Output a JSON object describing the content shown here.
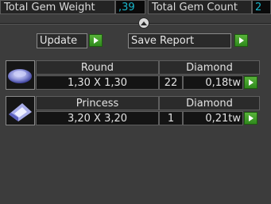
{
  "header": {
    "weight_label": "Total Gem Weight",
    "weight_value": ",39",
    "count_label": "Total Gem Count",
    "count_value": "2"
  },
  "actions": {
    "update_label": "Update",
    "save_label": "Save Report"
  },
  "gems": [
    {
      "shape": "Round",
      "material": "Diamond",
      "size": "1,30 X 1,30",
      "count": "22",
      "weight": "0,18tw"
    },
    {
      "shape": "Princess",
      "material": "Diamond",
      "size": "3,20 X 3,20",
      "count": "1",
      "weight": "0,21tw"
    }
  ],
  "colors": {
    "accent": "#19b7cc",
    "go_button": "#3f9b26"
  },
  "icons": [
    "chevron-up-icon",
    "arrow-right-icon",
    "round-gem-icon",
    "princess-gem-icon"
  ]
}
